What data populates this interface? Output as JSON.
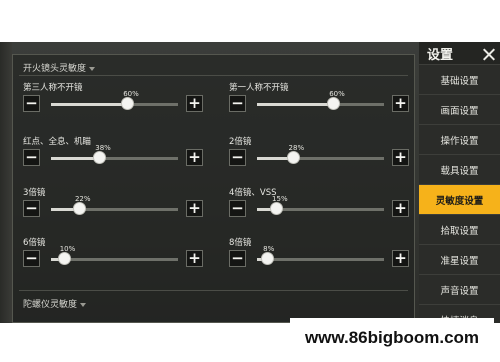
{
  "panel": {
    "section_fire": "开火镜头灵敏度",
    "section_gyro": "陀螺仪灵敏度"
  },
  "settings": [
    {
      "label": "第三人称不开镜",
      "value_text": "60%",
      "value": 60
    },
    {
      "label": "第一人称不开镜",
      "value_text": "60%",
      "value": 60
    },
    {
      "label": "红点、全息、机瞄",
      "value_text": "38%",
      "value": 38
    },
    {
      "label": "2倍镜",
      "value_text": "28%",
      "value": 28
    },
    {
      "label": "3倍镜",
      "value_text": "22%",
      "value": 22
    },
    {
      "label": "4倍镜、VSS",
      "value_text": "15%",
      "value": 15
    },
    {
      "label": "6倍镜",
      "value_text": "10%",
      "value": 10
    },
    {
      "label": "8倍镜",
      "value_text": "8%",
      "value": 8
    }
  ],
  "buttons": {
    "minus": "−",
    "plus": "+"
  },
  "sidebar": {
    "title": "设置",
    "items": [
      {
        "label": "基础设置",
        "active": false
      },
      {
        "label": "画面设置",
        "active": false
      },
      {
        "label": "操作设置",
        "active": false
      },
      {
        "label": "载具设置",
        "active": false
      },
      {
        "label": "灵敏度设置",
        "active": true
      },
      {
        "label": "拾取设置",
        "active": false
      },
      {
        "label": "准星设置",
        "active": false
      },
      {
        "label": "声音设置",
        "active": false
      },
      {
        "label": "快捷消息",
        "active": false
      }
    ]
  },
  "watermark": "www.86bigboom.com",
  "colors": {
    "accent": "#f6b21a",
    "panel_bg": "#343632",
    "sidebar_bg": "#242522"
  }
}
